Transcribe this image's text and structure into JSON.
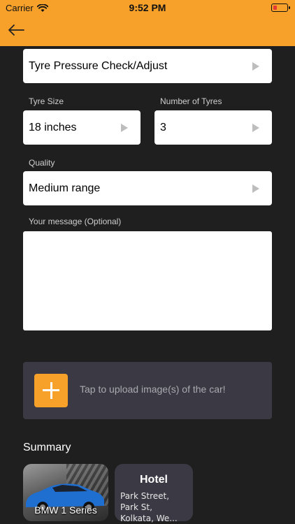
{
  "status_bar": {
    "carrier": "Carrier",
    "time": "9:52 PM"
  },
  "colors": {
    "accent": "#f7a12b",
    "background": "#1f1f1f",
    "card": "#3b3a44"
  },
  "header": {
    "back_icon": "arrow-left-icon"
  },
  "service": {
    "value": "Tyre Pressure Check/Adjust"
  },
  "tyre_size": {
    "label": "Tyre Size",
    "value": "18 inches"
  },
  "num_tyres": {
    "label": "Number of Tyres",
    "value": "3"
  },
  "quality": {
    "label": "Quality",
    "value": "Medium range"
  },
  "message": {
    "label": "Your message (Optional)",
    "value": ""
  },
  "upload": {
    "text": "Tap to upload image(s) of the car!"
  },
  "summary": {
    "title": "Summary",
    "car": {
      "label": "BMW 1 Series"
    },
    "hotel": {
      "title": "Hotel",
      "address": "Park Street, Park St, Kolkata, We..."
    }
  }
}
